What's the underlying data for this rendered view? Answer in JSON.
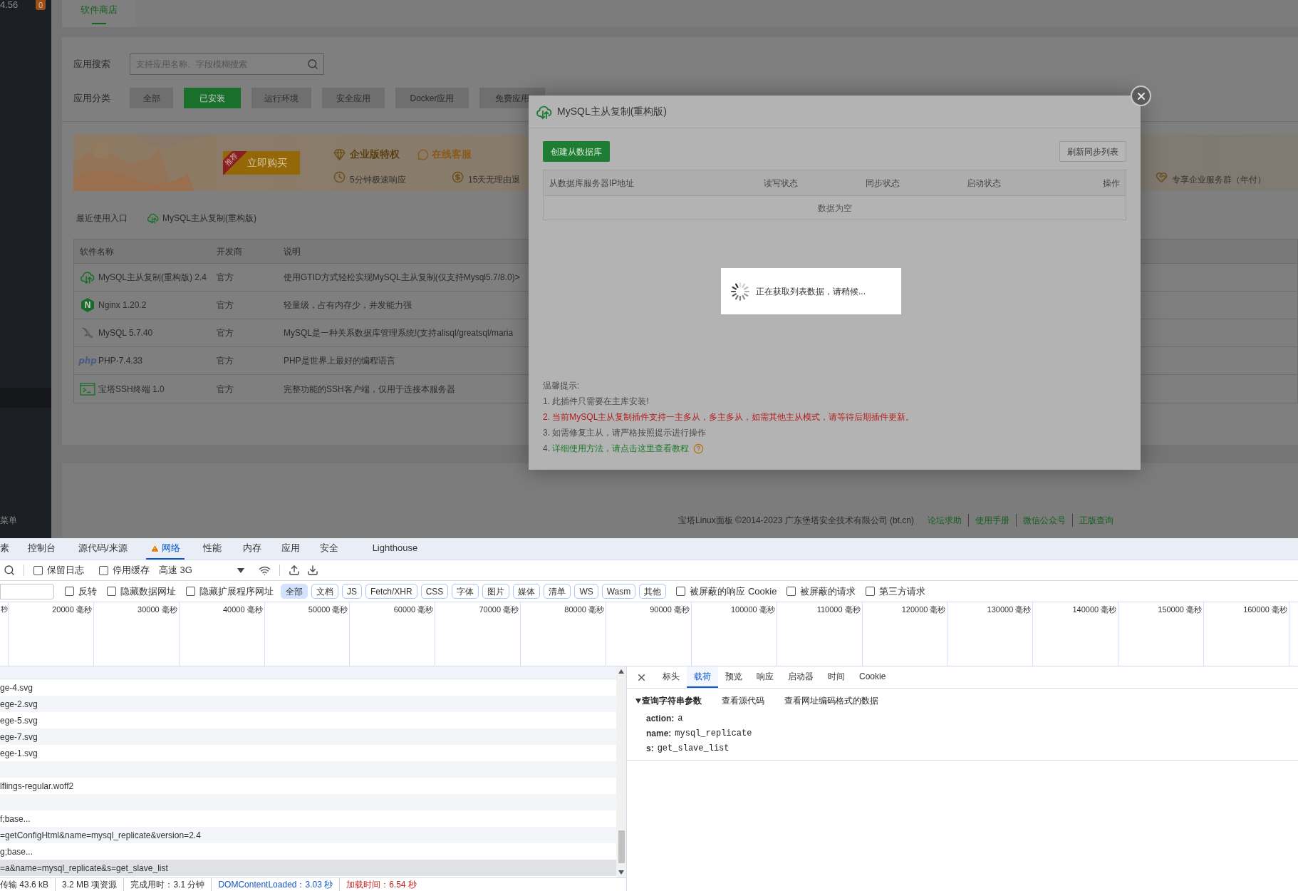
{
  "sidebar": {
    "version": "4.56",
    "badge": "0",
    "bottom_label": "菜单"
  },
  "page_tabs": [
    {
      "label": "软件商店",
      "selected": true
    }
  ],
  "search": {
    "label": "应用搜索",
    "placeholder": "支持应用名称、字段模糊搜索"
  },
  "categories": {
    "label": "应用分类",
    "items": [
      {
        "label": "全部",
        "selected": false
      },
      {
        "label": "已安装",
        "selected": true
      },
      {
        "label": "运行环境",
        "selected": false
      },
      {
        "label": "安全应用",
        "selected": false
      },
      {
        "label": "Docker应用",
        "selected": false
      },
      {
        "label": "免费应用",
        "selected": false
      }
    ]
  },
  "banner": {
    "ribbon": "推荐",
    "buy_button": "立即购买",
    "title": "企业版特权",
    "service": "在线客服",
    "perks": [
      {
        "kind": "clock",
        "text": "5分钟极速响应"
      },
      {
        "kind": "refund",
        "text": "15天无理由退"
      },
      {
        "kind": "heart",
        "text": "专享企业服务群（年付）"
      }
    ]
  },
  "recent": {
    "label": "最近使用入口",
    "links": [
      "MySQL主从复制(重构版)"
    ]
  },
  "software_table": {
    "columns": [
      "软件名称",
      "开发商",
      "说明"
    ],
    "rows": [
      {
        "kind": "cloud",
        "name": "MySQL主从复制(重构版) 2.4",
        "developer": "官方",
        "description": "使用GTID方式轻松实现MySQL主从复制(仅支持Mysql5.7/8.0)>"
      },
      {
        "kind": "nginx",
        "logo_text": "N",
        "name": "Nginx 1.20.2",
        "developer": "官方",
        "description": "轻量级，占有内存少，并发能力强"
      },
      {
        "kind": "dolphin",
        "name": "MySQL 5.7.40",
        "developer": "官方",
        "description": "MySQL是一种关系数据库管理系统!(支持alisql/greatsql/maria"
      },
      {
        "kind": "php",
        "logo_text": "php",
        "name": "PHP-7.4.33",
        "developer": "官方",
        "description": "PHP是世界上最好的编程语言"
      },
      {
        "kind": "terminal",
        "name": "宝塔SSH终端 1.0",
        "developer": "官方",
        "description": "完整功能的SSH客户端，仅用于连接本服务器"
      }
    ]
  },
  "footer": {
    "copyright": "宝塔Linux面板 ©2014-2023 广东堡塔安全技术有限公司 (bt.cn)",
    "links": [
      "论坛求助",
      "使用手册",
      "微信公众号",
      "正版查询"
    ]
  },
  "dialog": {
    "title": "MySQL主从复制(重构版)",
    "create_button": "创建从数据库",
    "refresh_button": "刷新同步列表",
    "columns": [
      "从数据库服务器IP地址",
      "读写状态",
      "同步状态",
      "启动状态",
      "操作"
    ],
    "empty_text": "数据为空",
    "loading_text": "正在获取列表数据，请稍候...",
    "tips_title": "温馨提示:",
    "tips": [
      {
        "kind": "plain",
        "text": "1. 此插件只需要在主库安装!"
      },
      {
        "kind": "warning",
        "text": "2. 当前MySQL主从复制插件支持一主多从，多主多从，如需其他主从模式，请等待后期插件更新。"
      },
      {
        "kind": "plain",
        "text": "3. 如需修复主从，请严格按照提示进行操作"
      },
      {
        "kind": "link",
        "text": "4. ",
        "link": "详细使用方法，请点击这里查看教程"
      }
    ]
  },
  "devtools": {
    "tabs": [
      {
        "label": "素",
        "selected": false,
        "warning": false
      },
      {
        "label": "控制台",
        "selected": false,
        "warning": false
      },
      {
        "label": "源代码/来源",
        "selected": false,
        "warning": false
      },
      {
        "label": "网络",
        "selected": true,
        "warning": true
      },
      {
        "label": "性能",
        "selected": false,
        "warning": false
      },
      {
        "label": "内存",
        "selected": false,
        "warning": false
      },
      {
        "label": "应用",
        "selected": false,
        "warning": false
      },
      {
        "label": "安全",
        "selected": false,
        "warning": false
      },
      {
        "label": "Lighthouse",
        "selected": false,
        "warning": false
      }
    ],
    "toolbar": {
      "checkboxes": [
        {
          "label": "保留日志",
          "checked": false
        },
        {
          "label": "停用缓存",
          "checked": false
        }
      ],
      "throttle": "高速 3G"
    },
    "filter": {
      "checkboxes": [
        {
          "label": "反转",
          "checked": false
        },
        {
          "label": "隐藏数据网址",
          "checked": false
        },
        {
          "label": "隐藏扩展程序网址",
          "checked": false
        }
      ],
      "types": [
        {
          "label": "全部",
          "selected": true
        },
        {
          "label": "文档",
          "selected": false
        },
        {
          "label": "JS",
          "selected": false
        },
        {
          "label": "Fetch/XHR",
          "selected": false
        },
        {
          "label": "CSS",
          "selected": false
        },
        {
          "label": "字体",
          "selected": false
        },
        {
          "label": "图片",
          "selected": false
        },
        {
          "label": "媒体",
          "selected": false
        },
        {
          "label": "清单",
          "selected": false
        },
        {
          "label": "WS",
          "selected": false
        },
        {
          "label": "Wasm",
          "selected": false
        },
        {
          "label": "其他",
          "selected": false
        }
      ],
      "more_checkboxes": [
        {
          "label": "被屏蔽的响应 Cookie",
          "checked": false
        },
        {
          "label": "被屏蔽的请求",
          "checked": false
        },
        {
          "label": "第三方请求",
          "checked": false
        }
      ]
    },
    "timeline_ticks": [
      "秒",
      "20000 毫秒",
      "30000 毫秒",
      "40000 毫秒",
      "50000 毫秒",
      "60000 毫秒",
      "70000 毫秒",
      "80000 毫秒",
      "90000 毫秒",
      "100000 毫秒",
      "110000 毫秒",
      "120000 毫秒",
      "130000 毫秒",
      "140000 毫秒",
      "150000 毫秒",
      "160000 毫秒"
    ],
    "requests": [
      {
        "name": "ge-4.svg",
        "selected": false
      },
      {
        "name": "ege-2.svg",
        "selected": false
      },
      {
        "name": "ege-5.svg",
        "selected": false
      },
      {
        "name": "ege-7.svg",
        "selected": false
      },
      {
        "name": "ege-1.svg",
        "selected": false
      },
      {
        "selected": false
      },
      {
        "name": "lflings-regular.woff2",
        "selected": false
      },
      {
        "selected": false
      },
      {
        "name": "f;base...",
        "selected": false
      },
      {
        "name": "=getConfigHtml&name=mysql_replicate&version=2.4",
        "selected": false
      },
      {
        "name": "g;base...",
        "selected": false
      },
      {
        "name": "=a&name=mysql_replicate&s=get_slave_list",
        "selected": true
      }
    ],
    "status": [
      {
        "kind": "plain",
        "text": "传输 43.6 kB"
      },
      {
        "kind": "plain",
        "text": "3.2 MB 项资源"
      },
      {
        "kind": "plain",
        "text": "完成用时：3.1 分钟"
      },
      {
        "kind": "dom",
        "text": "DOMContentLoaded：3.03 秒"
      },
      {
        "kind": "load",
        "text": "加载时间：6.54 秒"
      }
    ],
    "detail_tabs": [
      {
        "label": "标头",
        "selected": false
      },
      {
        "label": "载荷",
        "selected": true
      },
      {
        "label": "预览",
        "selected": false
      },
      {
        "label": "响应",
        "selected": false
      },
      {
        "label": "启动器",
        "selected": false
      },
      {
        "label": "时间",
        "selected": false
      },
      {
        "label": "Cookie",
        "selected": false
      }
    ],
    "payload": {
      "section": "查询字符串参数",
      "expanded": true,
      "view_source": "查看源代码",
      "view_encoded": "查看网址编码格式的数据",
      "params": [
        {
          "key": "action:",
          "value": "a"
        },
        {
          "key": "name:",
          "value": "mysql_replicate"
        },
        {
          "key": "s:",
          "value": "get_slave_list"
        }
      ]
    }
  }
}
